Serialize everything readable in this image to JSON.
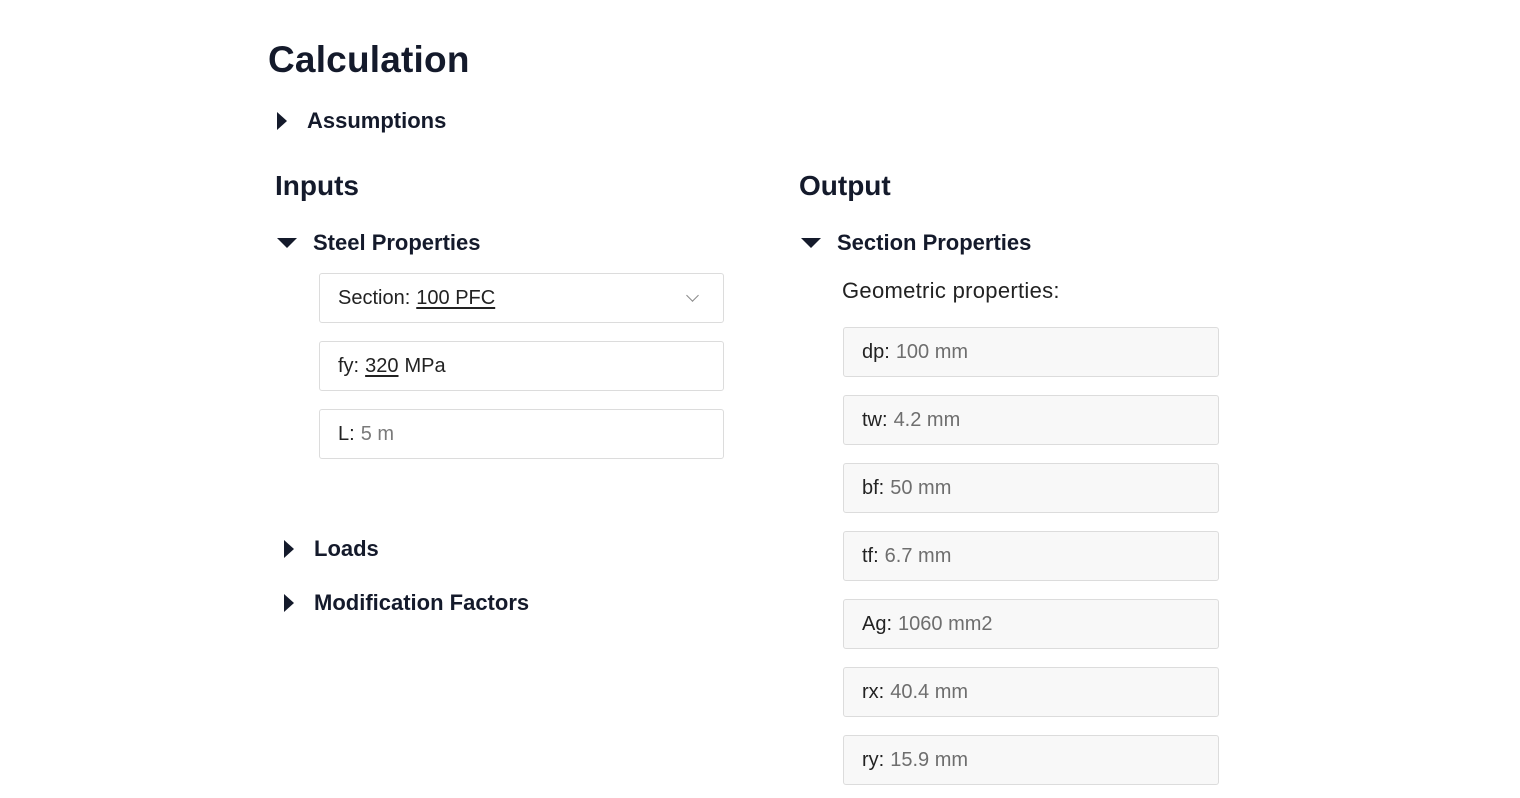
{
  "page": {
    "title": "Calculation"
  },
  "assumptions": {
    "label": "Assumptions"
  },
  "inputs": {
    "heading": "Inputs",
    "steel_properties": {
      "label": "Steel Properties",
      "section": {
        "label": "Section:",
        "value": "100 PFC"
      },
      "fy": {
        "label": "fy:",
        "value": "320",
        "unit": "MPa"
      },
      "length": {
        "label": "L:",
        "value": "5 m"
      }
    },
    "loads": {
      "label": "Loads"
    },
    "modification_factors": {
      "label": "Modification Factors"
    }
  },
  "output": {
    "heading": "Output",
    "section_properties": {
      "label": "Section Properties",
      "geometric_label": "Geometric properties:",
      "props": [
        {
          "label": "dp:",
          "value": "100 mm"
        },
        {
          "label": "tw:",
          "value": "4.2 mm"
        },
        {
          "label": "bf:",
          "value": "50 mm"
        },
        {
          "label": "tf:",
          "value": "6.7 mm"
        },
        {
          "label": "Ag:",
          "value": "1060 mm2"
        },
        {
          "label": "rx:",
          "value": "40.4 mm"
        },
        {
          "label": "ry:",
          "value": "15.9 mm"
        }
      ]
    }
  },
  "icons": {
    "collapsed": "triangle-right-icon",
    "expanded": "triangle-down-icon",
    "dropdown": "chevron-down-icon"
  }
}
